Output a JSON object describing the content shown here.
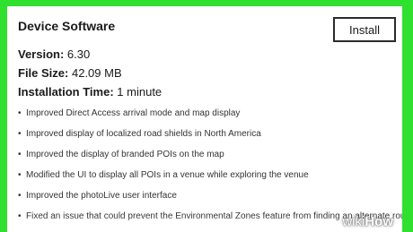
{
  "panel": {
    "title": "Device Software",
    "install_label": "Install",
    "version_label": "Version:",
    "version_value": "6.30",
    "filesize_label": "File Size:",
    "filesize_value": "42.09 MB",
    "installtime_label": "Installation Time:",
    "installtime_value": "1 minute"
  },
  "notes": [
    "Improved Direct Access arrival mode and map display",
    "Improved display of localized road shields in North America",
    "Improved the display of branded POIs on the map",
    "Modified the UI to display all POIs in a venue while exploring the venue",
    "Improved the photoLive user interface",
    "Fixed an issue that could prevent the Environmental Zones feature from finding an alternate route"
  ],
  "watermark": {
    "part1": "wiki",
    "part2": "How"
  },
  "colors": {
    "border_green": "#2fe02f",
    "panel_bg": "#ffffff"
  }
}
